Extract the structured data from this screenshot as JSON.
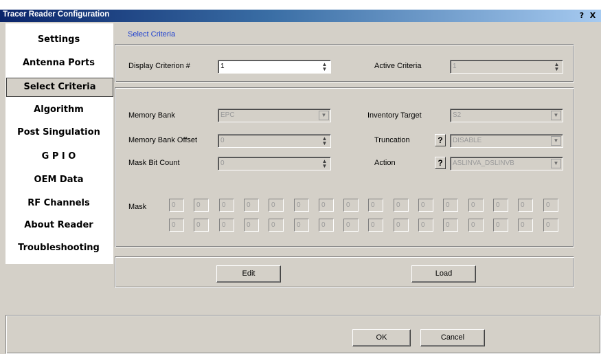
{
  "window": {
    "title": "Tracer Reader Configuration",
    "help_glyph": "?",
    "close_glyph": "X"
  },
  "sidebar": {
    "items": [
      {
        "label": "Settings",
        "selected": false
      },
      {
        "label": "Antenna Ports",
        "selected": false
      },
      {
        "label": "Select Criteria",
        "selected": true
      },
      {
        "label": "Algorithm",
        "selected": false
      },
      {
        "label": "Post Singulation",
        "selected": false
      },
      {
        "label": "G P I O",
        "selected": false
      },
      {
        "label": "OEM Data",
        "selected": false
      },
      {
        "label": "RF Channels",
        "selected": false
      },
      {
        "label": "About Reader",
        "selected": false
      },
      {
        "label": "Troubleshooting",
        "selected": false
      }
    ]
  },
  "main": {
    "heading": "Select Criteria",
    "display_criterion": {
      "label": "Display Criterion #",
      "value": "1"
    },
    "active_criteria": {
      "label": "Active Criteria",
      "value": "1"
    },
    "memory_bank": {
      "label": "Memory Bank",
      "value": "EPC"
    },
    "memory_bank_offset": {
      "label": "Memory Bank Offset",
      "value": "0"
    },
    "mask_bit_count": {
      "label": "Mask Bit Count",
      "value": "0"
    },
    "inventory_target": {
      "label": "Inventory Target",
      "value": "S2"
    },
    "truncation": {
      "label": "Truncation",
      "help": "?",
      "value": "DISABLE"
    },
    "action": {
      "label": "Action",
      "help": "?",
      "value": "ASLINVA_DSLINVB"
    },
    "mask": {
      "label": "Mask",
      "row1": [
        "0",
        "0",
        "0",
        "0",
        "0",
        "0",
        "0",
        "0",
        "0",
        "0",
        "0",
        "0",
        "0",
        "0",
        "0",
        "0"
      ],
      "row2": [
        "0",
        "0",
        "0",
        "0",
        "0",
        "0",
        "0",
        "0",
        "0",
        "0",
        "0",
        "0",
        "0",
        "0",
        "0",
        "0"
      ]
    },
    "edit_label": "Edit",
    "load_label": "Load"
  },
  "footer": {
    "ok_label": "OK",
    "cancel_label": "Cancel"
  },
  "colors": {
    "title_start": "#0a246a",
    "title_end": "#a6caf0",
    "dialog": "#d4d0c8",
    "heading": "#1c3fcf"
  }
}
